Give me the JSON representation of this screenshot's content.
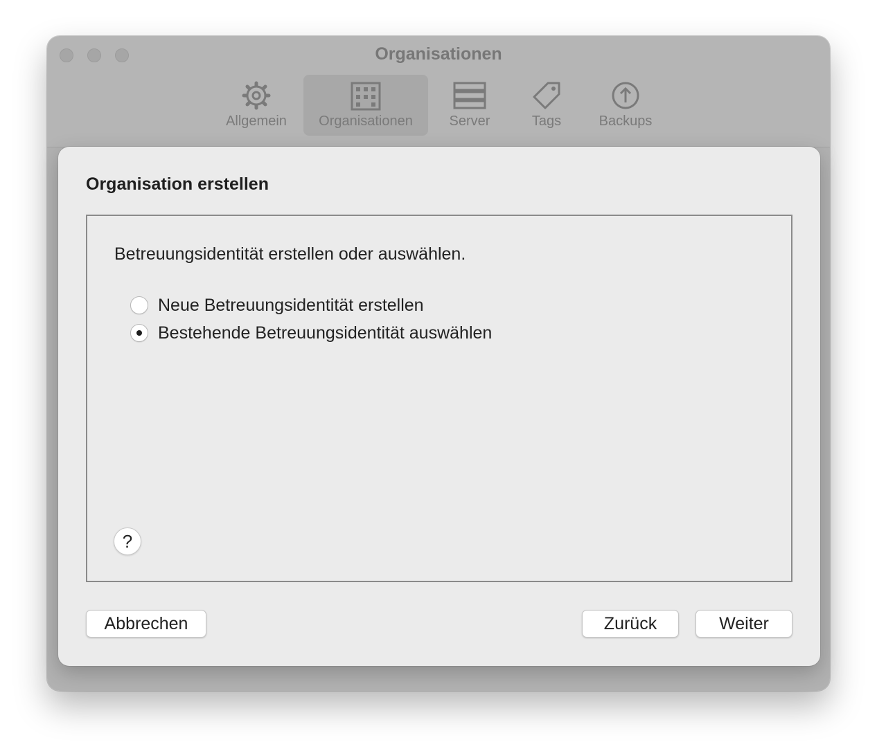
{
  "window": {
    "title": "Organisationen",
    "toolbar": [
      {
        "label": "Allgemein",
        "icon": "gear-icon",
        "selected": false
      },
      {
        "label": "Organisationen",
        "icon": "building-icon",
        "selected": true
      },
      {
        "label": "Server",
        "icon": "server-icon",
        "selected": false
      },
      {
        "label": "Tags",
        "icon": "tag-icon",
        "selected": false
      },
      {
        "label": "Backups",
        "icon": "backup-icon",
        "selected": false
      }
    ]
  },
  "sheet": {
    "title": "Organisation erstellen",
    "prompt": "Betreuungsidentität erstellen oder auswählen.",
    "options": [
      {
        "label": "Neue Betreuungsidentität erstellen",
        "checked": false
      },
      {
        "label": "Bestehende Betreuungsidentität auswählen",
        "checked": true
      }
    ],
    "help_label": "?",
    "buttons": {
      "cancel": "Abbrechen",
      "back": "Zurück",
      "next": "Weiter"
    }
  }
}
